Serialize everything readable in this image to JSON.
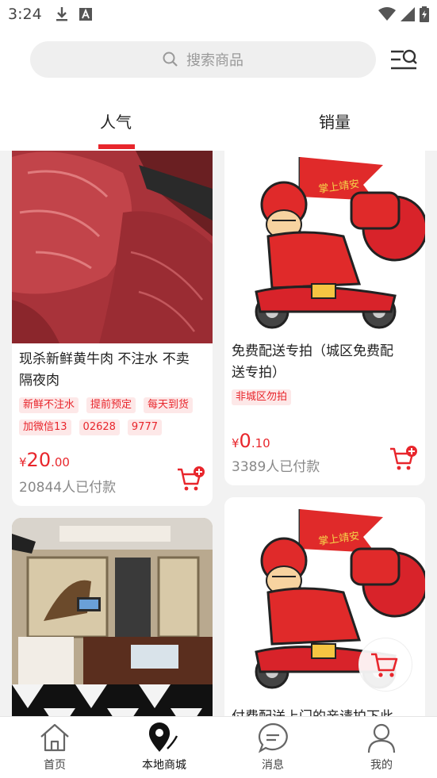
{
  "status_bar": {
    "time": "3:24"
  },
  "search": {
    "placeholder": "搜索商品"
  },
  "tabs": [
    {
      "label": "人气",
      "active": true
    },
    {
      "label": "销量",
      "active": false
    }
  ],
  "products": [
    {
      "title": "现杀新鲜黄牛肉 不注水 不卖隔夜肉",
      "title_line1": "现杀新鲜黄牛肉 不注水 不卖",
      "title_line2": "隔夜肉",
      "tags": [
        "新鲜不注水",
        "提前预定",
        "每天到货",
        "加微信13",
        "02628",
        "9777"
      ],
      "price_currency": "¥",
      "price_int": "20",
      "price_dec": ".00",
      "paid_count": "20844人已付款"
    },
    {
      "title": "免费配送专拍（城区免费配送专拍）",
      "title_line1": "免费配送专拍（城区免费配",
      "title_line2": "送专拍）",
      "tags": [
        "非城区勿拍"
      ],
      "price_currency": "¥",
      "price_int": "0",
      "price_dec": ".10",
      "paid_count": "3389人已付款"
    },
    {
      "title": "",
      "image": "karaoke-room-photo"
    },
    {
      "title_partial": "付费配送上门的亲请拍下此",
      "image": "delivery-mascot",
      "flag_text": "掌上靖安"
    }
  ],
  "mascot_flag_text": "掌上靖安",
  "bottom_nav": [
    {
      "label": "首页",
      "icon": "home-icon",
      "active": false
    },
    {
      "label": "本地商城",
      "icon": "location-pin-icon",
      "active": true
    },
    {
      "label": "消息",
      "icon": "chat-bubble-icon",
      "active": false
    },
    {
      "label": "我的",
      "icon": "user-icon",
      "active": false
    }
  ],
  "colors": {
    "accent": "#e8262c",
    "tag_bg": "#fde8e8",
    "page_bg": "#f2f2f2"
  }
}
